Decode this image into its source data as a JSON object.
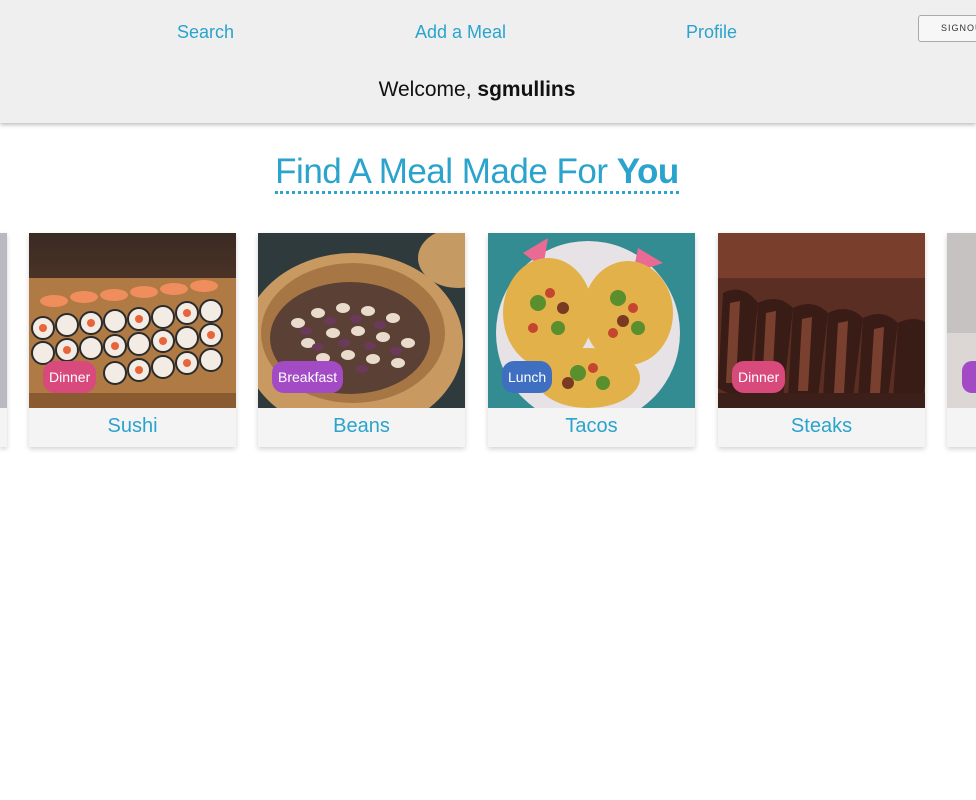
{
  "nav": {
    "search": "Search",
    "add_meal": "Add a Meal",
    "profile": "Profile",
    "signout": "SIGNOUT"
  },
  "welcome": {
    "prefix": "Welcome,",
    "username": "sgmullins"
  },
  "heading": {
    "text": "Find A Meal Made For",
    "emphasis": "You"
  },
  "meals": [
    {
      "name": "Sushi",
      "category": "Dinner",
      "badge_color": "#d84a7c"
    },
    {
      "name": "Beans",
      "category": "Breakfast",
      "badge_color": "#a34bc4"
    },
    {
      "name": "Tacos",
      "category": "Lunch",
      "badge_color": "#3f6fc0"
    },
    {
      "name": "Steaks",
      "category": "Dinner",
      "badge_color": "#d84a7c"
    }
  ],
  "colors": {
    "accent": "#2aa3cd",
    "header_bg": "#efefef"
  }
}
